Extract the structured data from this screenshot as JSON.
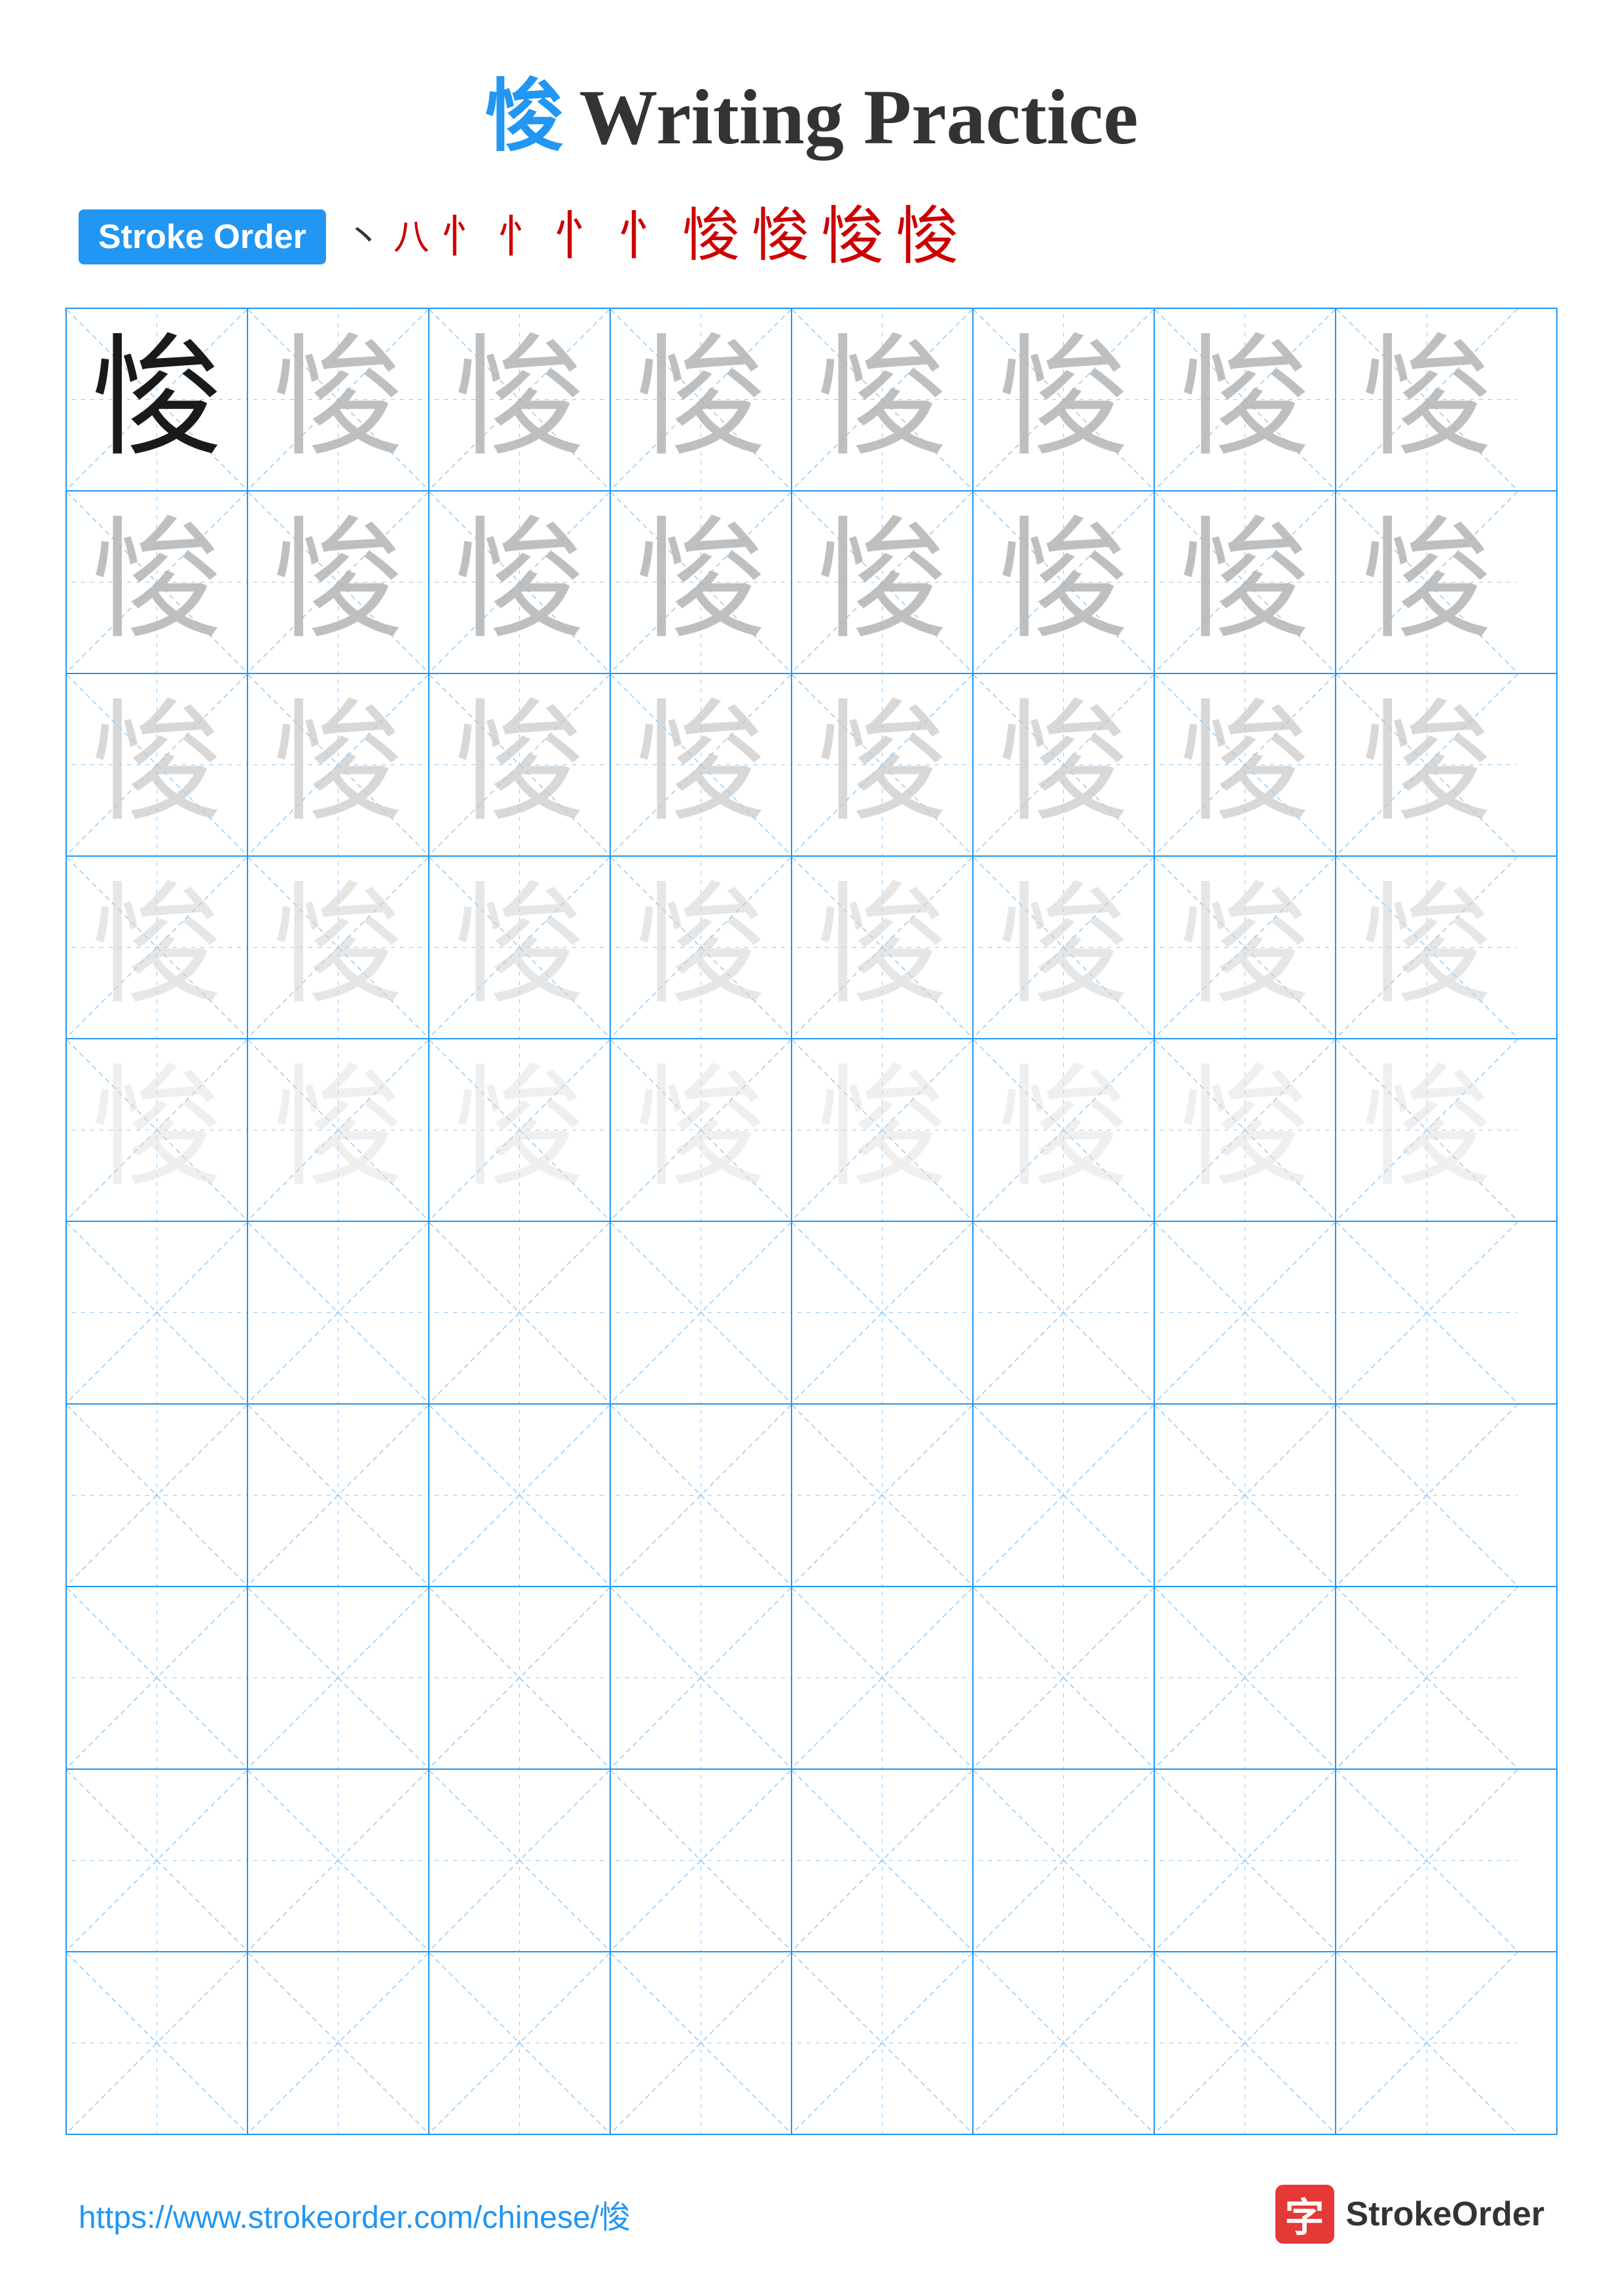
{
  "title": {
    "char": "悛",
    "text": "Writing Practice"
  },
  "stroke_order": {
    "badge_label": "Stroke Order",
    "strokes": [
      "丶",
      "八",
      "忄",
      "忄忄",
      "忄忄忄",
      "悛partial1",
      "悛partial2",
      "悛partial3",
      "悛partial4",
      "悛"
    ]
  },
  "grid": {
    "cols": 8,
    "rows": 10,
    "practice_char": "悛"
  },
  "footer": {
    "url": "https://www.strokeorder.com/chinese/悛",
    "logo_char": "字",
    "logo_text": "StrokeOrder"
  }
}
